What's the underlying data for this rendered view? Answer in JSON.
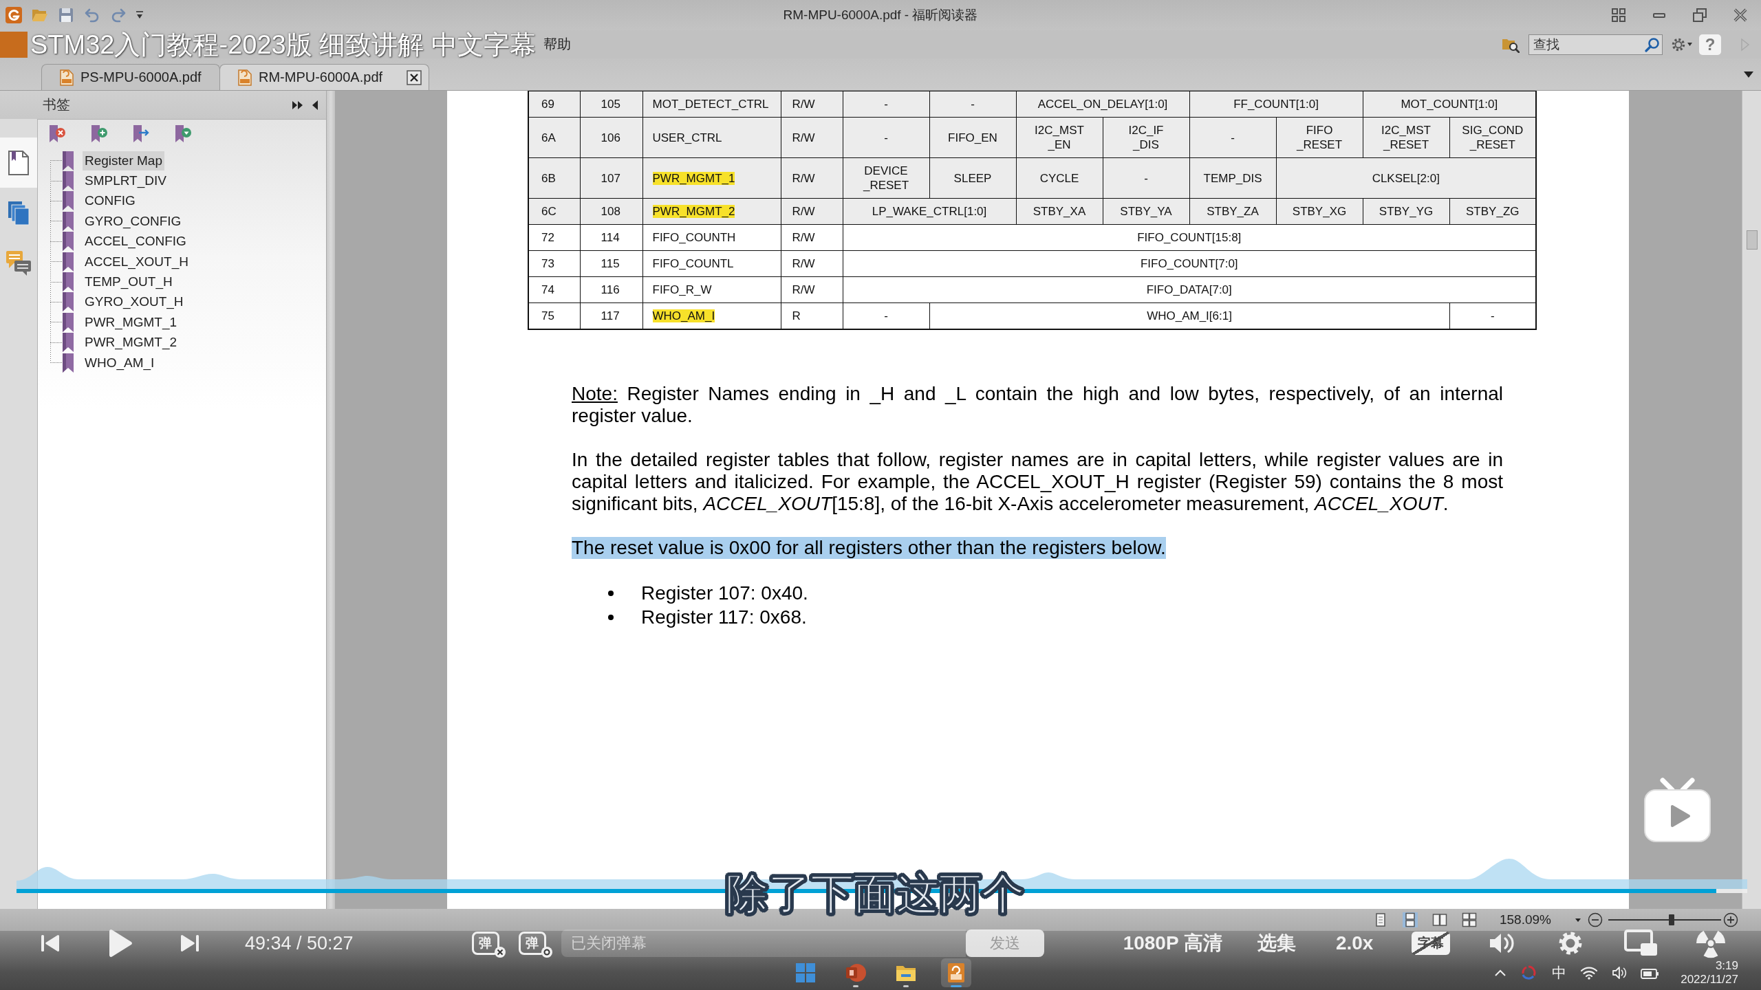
{
  "window": {
    "title": "RM-MPU-6000A.pdf - 福昕阅读器"
  },
  "video": {
    "title": "STM32入门教程-2023版 细致讲解 中文字幕",
    "subtitle": "除了下面这两个"
  },
  "menu": {
    "items": [
      {
        "label": "帮助"
      }
    ],
    "search": {
      "placeholder": "查找"
    },
    "help_button": "?"
  },
  "tabs": [
    {
      "label": "PS-MPU-6000A.pdf",
      "selected": false
    },
    {
      "label": "RM-MPU-6000A.pdf",
      "selected": true
    }
  ],
  "sidebar": {
    "title": "书签",
    "rail": [
      {
        "kind": "bookmarks",
        "selected": true
      },
      {
        "kind": "pages",
        "selected": false
      },
      {
        "kind": "comments",
        "selected": false
      }
    ],
    "bookmarks": [
      {
        "label": "Register Map",
        "selected": true
      },
      {
        "label": "SMPLRT_DIV",
        "selected": false
      },
      {
        "label": "CONFIG",
        "selected": false
      },
      {
        "label": "GYRO_CONFIG",
        "selected": false
      },
      {
        "label": "ACCEL_CONFIG",
        "selected": false
      },
      {
        "label": "ACCEL_XOUT_H",
        "selected": false
      },
      {
        "label": "TEMP_OUT_H",
        "selected": false
      },
      {
        "label": "GYRO_XOUT_H",
        "selected": false
      },
      {
        "label": "PWR_MGMT_1",
        "selected": false
      },
      {
        "label": "PWR_MGMT_2",
        "selected": false
      },
      {
        "label": "WHO_AM_I",
        "selected": false
      }
    ]
  },
  "document": {
    "table": {
      "rows": [
        {
          "hex": "69",
          "dec": "105",
          "name": "MOT_DETECT_CTRL",
          "highlighted": false,
          "access": "R/W",
          "shaded": true,
          "fields": [
            {
              "text": "-",
              "kind": "bit"
            },
            {
              "text": "-",
              "kind": "bit"
            },
            {
              "text": "ACCEL_ON_DELAY[1:0]",
              "kind": "pair"
            },
            {
              "text": "FF_COUNT[1:0]",
              "kind": "pair"
            },
            {
              "text": "MOT_COUNT[1:0]",
              "kind": "pair"
            }
          ]
        },
        {
          "hex": "6A",
          "dec": "106",
          "name": "USER_CTRL",
          "highlighted": false,
          "access": "R/W",
          "shaded": true,
          "fields": [
            {
              "text": "-",
              "kind": "bit"
            },
            {
              "text": "FIFO_EN",
              "kind": "bit"
            },
            {
              "text": "I2C_MST\n_EN",
              "kind": "bit"
            },
            {
              "text": "I2C_IF\n_DIS",
              "kind": "bit"
            },
            {
              "text": "-",
              "kind": "bit"
            },
            {
              "text": "FIFO\n_RESET",
              "kind": "bit"
            },
            {
              "text": "I2C_MST\n_RESET",
              "kind": "bit"
            },
            {
              "text": "SIG_COND\n_RESET",
              "kind": "bit"
            }
          ]
        },
        {
          "hex": "6B",
          "dec": "107",
          "name": "PWR_MGMT_1",
          "highlighted": true,
          "access": "R/W",
          "shaded": true,
          "fields": [
            {
              "text": "DEVICE\n_RESET",
              "kind": "bit"
            },
            {
              "text": "SLEEP",
              "kind": "bit"
            },
            {
              "text": "CYCLE",
              "kind": "bit"
            },
            {
              "text": "-",
              "kind": "bit"
            },
            {
              "text": "TEMP_DIS",
              "kind": "bit"
            },
            {
              "text": "CLKSEL[2:0]",
              "kind": "triple"
            }
          ]
        },
        {
          "hex": "6C",
          "dec": "108",
          "name": "PWR_MGMT_2",
          "highlighted": true,
          "access": "R/W",
          "shaded": true,
          "fields": [
            {
              "text": "LP_WAKE_CTRL[1:0]",
              "kind": "pair"
            },
            {
              "text": "STBY_XA",
              "kind": "bit"
            },
            {
              "text": "STBY_YA",
              "kind": "bit"
            },
            {
              "text": "STBY_ZA",
              "kind": "bit"
            },
            {
              "text": "STBY_XG",
              "kind": "bit"
            },
            {
              "text": "STBY_YG",
              "kind": "bit"
            },
            {
              "text": "STBY_ZG",
              "kind": "bit"
            }
          ]
        },
        {
          "hex": "72",
          "dec": "114",
          "name": "FIFO_COUNTH",
          "highlighted": false,
          "access": "R/W",
          "shaded": false,
          "fields": [
            {
              "text": "FIFO_COUNT[15:8]",
              "kind": "byte"
            }
          ]
        },
        {
          "hex": "73",
          "dec": "115",
          "name": "FIFO_COUNTL",
          "highlighted": false,
          "access": "R/W",
          "shaded": false,
          "fields": [
            {
              "text": "FIFO_COUNT[7:0]",
              "kind": "byte"
            }
          ]
        },
        {
          "hex": "74",
          "dec": "116",
          "name": "FIFO_R_W",
          "highlighted": false,
          "access": "R/W",
          "shaded": false,
          "fields": [
            {
              "text": "FIFO_DATA[7:0]",
              "kind": "byte"
            }
          ]
        },
        {
          "hex": "75",
          "dec": "117",
          "name": "WHO_AM_I",
          "highlighted": true,
          "access": "R",
          "shaded": false,
          "fields": [
            {
              "text": "-",
              "kind": "bit"
            },
            {
              "text": "WHO_AM_I[6:1]",
              "kind": "sextet"
            },
            {
              "text": "-",
              "kind": "bit"
            }
          ]
        }
      ]
    },
    "note": {
      "label": "Note:",
      "text": "Register Names ending in _H and _L contain the high and low bytes, respectively, of an internal register value."
    },
    "paragraphs": [
      {
        "text": "In the detailed register tables that follow, register names are in capital letters, while register values are in capital letters and italicized. For example, the ACCEL_XOUT_H register (Register 59) contains the 8 most significant bits, *ACCEL_XOUT*[15:8], of the 16-bit X-Axis accelerometer measurement, *ACCEL_XOUT*.",
        "highlighted": false
      },
      {
        "text": "The reset value is 0x00 for all registers other than the registers below.",
        "highlighted": true
      }
    ],
    "bullets": [
      "Register 107: 0x40.",
      "Register 117: 0x68."
    ]
  },
  "status_bar": {
    "view_modes": [
      {
        "kind": "single",
        "selected": false
      },
      {
        "kind": "continuous",
        "selected": true
      },
      {
        "kind": "facing",
        "selected": false
      },
      {
        "kind": "continuous_facing",
        "selected": false
      }
    ],
    "zoom": "158.09%",
    "zoom_slider": {
      "level": 0.56
    }
  },
  "player": {
    "time": "49:34 / 50:27",
    "progress": {
      "level": 0.982
    },
    "danmaku_buttons": [
      {
        "kind": "off",
        "label": "弹"
      },
      {
        "kind": "settings",
        "label": "弹"
      }
    ],
    "danmaku_input": {
      "placeholder": "已关闭弹幕"
    },
    "send_button": "发送",
    "quality": "1080P 高清",
    "episodes": "选集",
    "speed": "2.0x",
    "subtitles": {
      "label": "字幕",
      "on": false
    }
  },
  "taskbar": {
    "apps": [
      {
        "kind": "start",
        "running": false,
        "selected": false
      },
      {
        "kind": "slides",
        "running": true,
        "selected": false
      },
      {
        "kind": "folder",
        "running": true,
        "selected": false
      },
      {
        "kind": "pdf",
        "running": true,
        "selected": true
      }
    ],
    "input_method": "中",
    "time": "3:19",
    "date": "2022/11/27"
  }
}
